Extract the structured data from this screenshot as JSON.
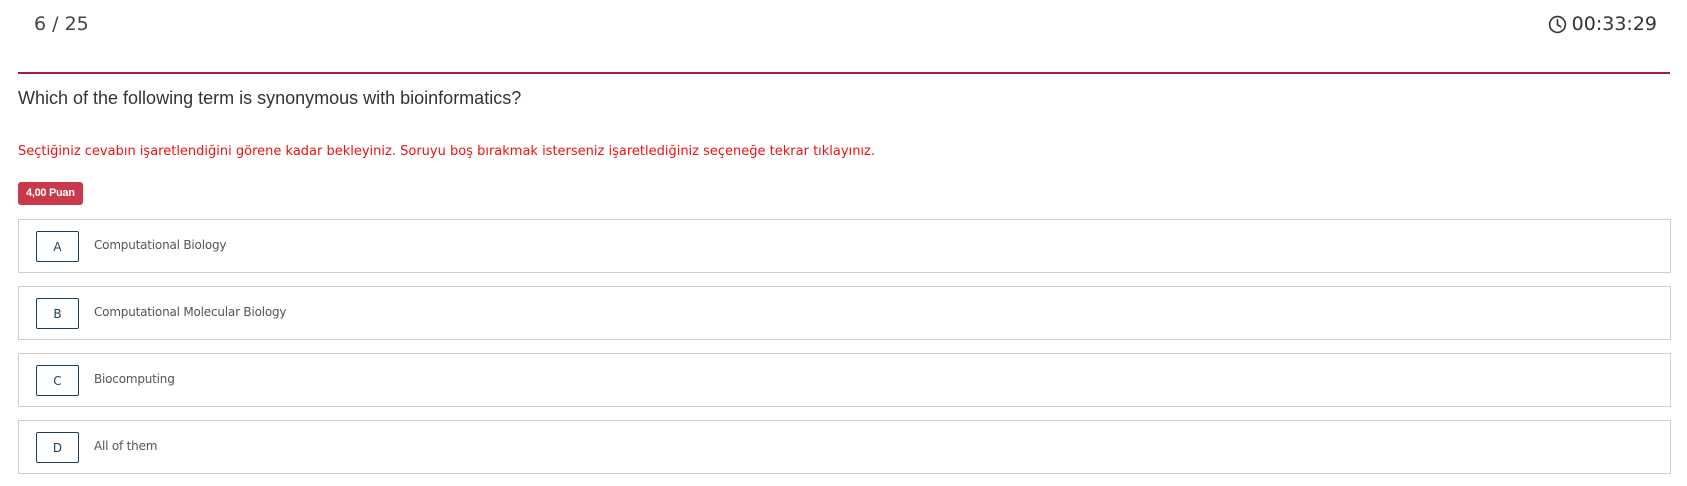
{
  "header": {
    "progress": "6 / 25",
    "timer": "00:33:29"
  },
  "question": {
    "text": "Which of the following term is synonymous with bioinformatics?",
    "warning": "Seçtiğiniz cevabın işaretlendiğini görene kadar bekleyiniz. Soruyu boş bırakmak isterseniz işaretlediğiniz seçeneğe tekrar tıklayınız.",
    "points": "4,00 Puan"
  },
  "options": [
    {
      "letter": "A",
      "text": "Computational Biology"
    },
    {
      "letter": "B",
      "text": "Computational Molecular Biology"
    },
    {
      "letter": "C",
      "text": "Biocomputing"
    },
    {
      "letter": "D",
      "text": "All of them"
    }
  ],
  "colors": {
    "accent": "#a31a3c",
    "badge": "#c83a4a",
    "warning": "#ee1111",
    "letter_border": "#1d3f5b"
  }
}
